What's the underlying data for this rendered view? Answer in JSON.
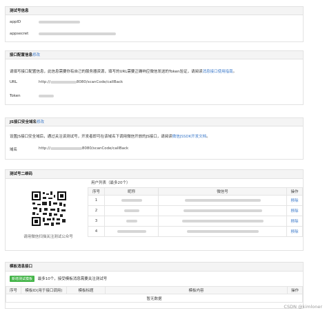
{
  "test_account": {
    "title": "测试号信息",
    "appid_label": "appID",
    "appsecret_label": "appsecret"
  },
  "interface_config": {
    "title": "接口配置信息",
    "edit": "修改",
    "desc_a": "请填写接口配置信息，此信息需要你有自己的服务器资源，填写的URL需要正确响应微信发送的Token验证，请阅读",
    "desc_link": "消息接口使用指南",
    "desc_b": "。",
    "url_label": "URL",
    "url_prefix": "http://",
    "url_suffix": "8080/scanCode/callBack",
    "token_label": "Token"
  },
  "js_domain": {
    "title": "JS接口安全域名",
    "edit": "修改",
    "desc_a": "设置JS接口安全域后，通过关注该测试号，开发者即可在该域名下调用微信开放的JS接口，请阅读",
    "desc_link": "微信JSSDK开发文档",
    "desc_b": "。",
    "domain_label": "域名",
    "domain_prefix": "http://",
    "domain_suffix": "8080/scanCode/callBack"
  },
  "qrcode": {
    "title": "测试号二维码",
    "caption": "请用微信扫描关注测试公众号",
    "user_list_title": "用户列表（最多20个）",
    "columns": [
      "序号",
      "昵称",
      "微信号",
      "操作"
    ],
    "rows": [
      {
        "no": "1",
        "action": "移除"
      },
      {
        "no": "2",
        "action": "移除"
      },
      {
        "no": "3",
        "action": "移除"
      },
      {
        "no": "4",
        "action": "移除"
      }
    ]
  },
  "template": {
    "title": "模板消息接口",
    "add_button": "新增测试模板",
    "note": "最多10个，接受模板消息需要关注测试号",
    "columns": [
      "序号",
      "模板ID(用于接口调用)",
      "模板标题",
      "模板内容",
      "操作"
    ],
    "empty": "暂无数据"
  },
  "watermark": "CSDN @kimloner"
}
